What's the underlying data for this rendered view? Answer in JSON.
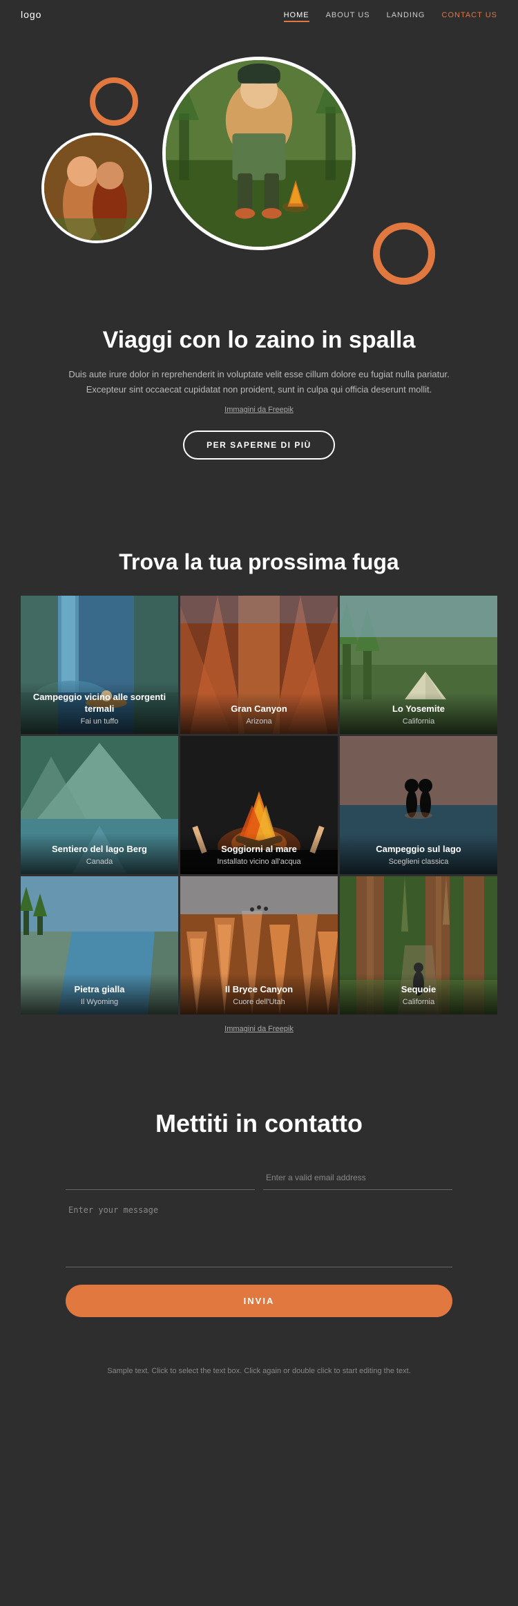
{
  "nav": {
    "logo": "logo",
    "links": [
      {
        "label": "HOME",
        "active": true
      },
      {
        "label": "ABOUT US",
        "active": false
      },
      {
        "label": "LANDING",
        "active": false
      },
      {
        "label": "CONTACT US",
        "active": false,
        "highlighted": true
      }
    ]
  },
  "hero": {
    "title": "Viaggi con lo zaino in spalla",
    "description": "Duis aute irure dolor in reprehenderit in voluptate velit esse cillum dolore eu fugiat nulla pariatur. Excepteur sint occaecat cupidatat non proident, sunt in culpa qui officia deserunt mollit.",
    "freepik_label": "Immagini da Freepik",
    "cta_button": "PER SAPERNE DI PIÙ"
  },
  "trova": {
    "title": "Trova la tua prossima fuga",
    "destinations": [
      {
        "title": "Campeggio vicino alle sorgenti termali",
        "subtitle": "Fai un tuffo",
        "bg": "waterfall"
      },
      {
        "title": "Gran Canyon",
        "subtitle": "Arizona",
        "bg": "canyon"
      },
      {
        "title": "Lo Yosemite",
        "subtitle": "California",
        "bg": "yosemite"
      },
      {
        "title": "Sentiero del lago Berg",
        "subtitle": "Canada",
        "bg": "berg"
      },
      {
        "title": "Soggiorni al mare",
        "subtitle": "Installato vicino all'acqua",
        "bg": "mare"
      },
      {
        "title": "Campeggio sul lago",
        "subtitle": "Sceglieni classica",
        "bg": "lago"
      },
      {
        "title": "Pietra gialla",
        "subtitle": "Il Wyoming",
        "bg": "pietra"
      },
      {
        "title": "Il Bryce Canyon",
        "subtitle": "Cuore dell'Utah",
        "bg": "bryce"
      },
      {
        "title": "Sequoie",
        "subtitle": "California",
        "bg": "sequoie"
      }
    ],
    "freepik_label": "Immagini da Freepik"
  },
  "contact": {
    "title": "Mettiti in contatto",
    "name_placeholder": "",
    "email_placeholder": "Enter a valid email address",
    "message_placeholder": "Enter your message",
    "submit_label": "INVIA"
  },
  "footer": {
    "text": "Sample text. Click to select the text box. Click again or double click to start editing the text."
  }
}
